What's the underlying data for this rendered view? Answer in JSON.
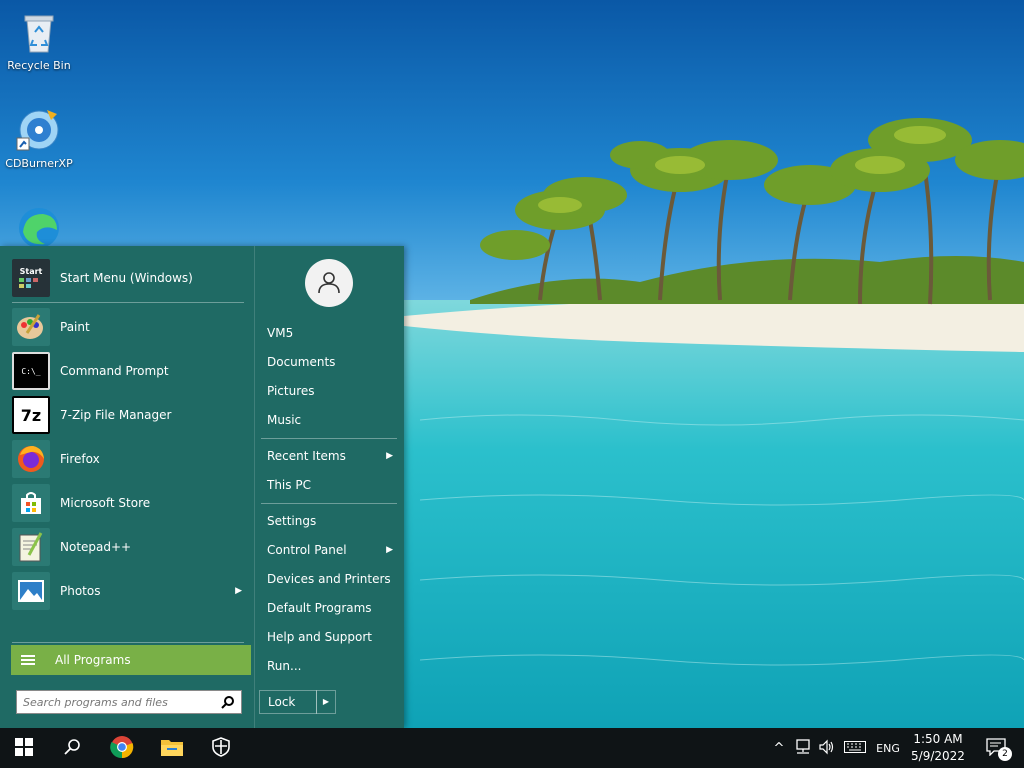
{
  "desktop": {
    "icons": [
      {
        "label": "Recycle Bin",
        "icon": "recycle-bin-icon"
      },
      {
        "label": "CDBurnerXP",
        "icon": "cd-burner-icon"
      },
      {
        "label": "",
        "icon": "edge-icon"
      }
    ]
  },
  "start_menu": {
    "pinned": {
      "label": "Start Menu (Windows)",
      "icon_text": "Start"
    },
    "programs": [
      {
        "label": "Paint",
        "icon": "paint-icon",
        "arrow": false
      },
      {
        "label": "Command Prompt",
        "icon": "cmd-icon",
        "arrow": false
      },
      {
        "label": "7-Zip File Manager",
        "icon": "7zip-icon",
        "arrow": false
      },
      {
        "label": "Firefox",
        "icon": "firefox-icon",
        "arrow": false
      },
      {
        "label": "Microsoft Store",
        "icon": "store-icon",
        "arrow": false
      },
      {
        "label": "Notepad++",
        "icon": "notepad-icon",
        "arrow": false
      },
      {
        "label": "Photos",
        "icon": "photos-icon",
        "arrow": true
      }
    ],
    "all_programs": "All Programs",
    "search_placeholder": "Search programs and files",
    "seven_zip_text": "7z",
    "cmd_text": "C:\\_",
    "right_links": [
      {
        "label": "VM5",
        "arrow": false
      },
      {
        "label": "Documents",
        "arrow": false
      },
      {
        "label": "Pictures",
        "arrow": false
      },
      {
        "label": "Music",
        "arrow": false
      },
      {
        "label": "Recent Items",
        "arrow": true
      },
      {
        "label": "This PC",
        "arrow": false
      },
      {
        "label": "Settings",
        "arrow": false
      },
      {
        "label": "Control Panel",
        "arrow": true
      },
      {
        "label": "Devices and Printers",
        "arrow": false
      },
      {
        "label": "Default Programs",
        "arrow": false
      },
      {
        "label": "Help and Support",
        "arrow": false
      },
      {
        "label": "Run...",
        "arrow": false
      }
    ],
    "lock_label": "Lock",
    "arrow_glyph": "▶"
  },
  "taskbar": {
    "language": "ENG",
    "time": "1:50 AM",
    "date": "5/9/2022",
    "notifications_count": "2",
    "chevron_glyph": "^"
  },
  "colors": {
    "menu_bg": "#1f6a64",
    "accent_green": "#79b047",
    "taskbar_bg": "#0f1416"
  }
}
